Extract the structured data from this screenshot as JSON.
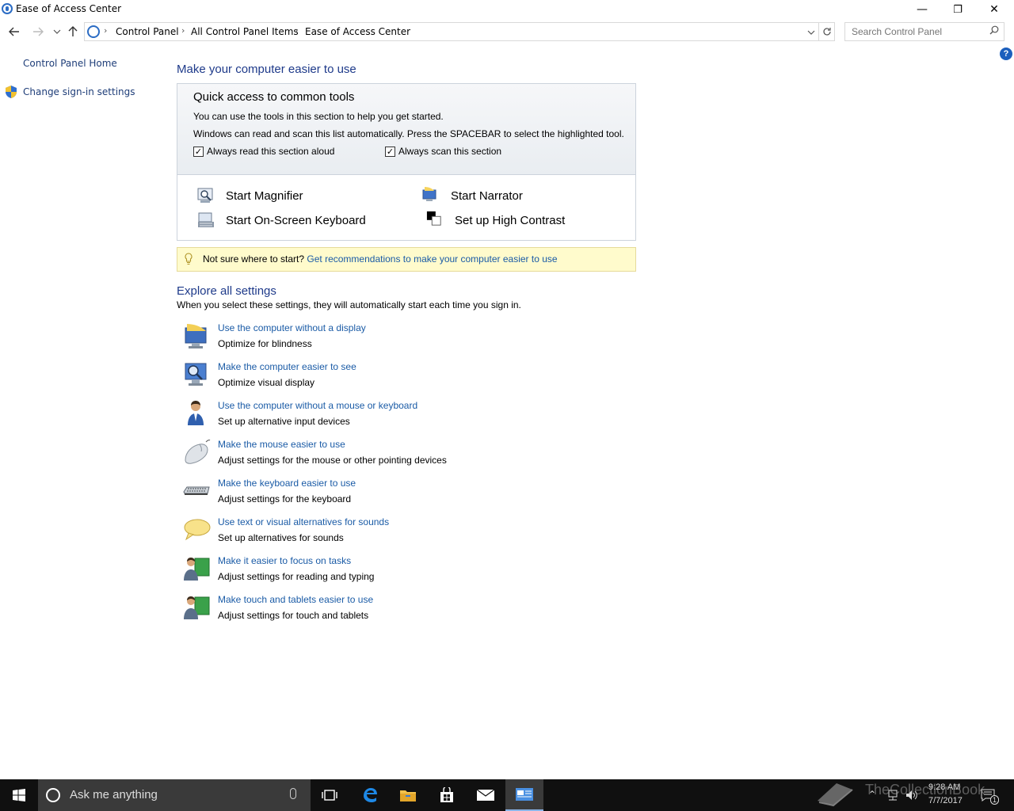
{
  "window": {
    "title": "Ease of Access Center",
    "minimize": "—",
    "restore": "❐",
    "close": "✕"
  },
  "address": {
    "crumbs": [
      "Control Panel",
      "All Control Panel Items",
      "Ease of Access Center"
    ],
    "search_placeholder": "Search Control Panel"
  },
  "left_nav": {
    "home": "Control Panel Home",
    "signin": "Change sign-in settings"
  },
  "help_label": "?",
  "main": {
    "heading": "Make your computer easier to use",
    "quick": {
      "heading": "Quick access to common tools",
      "line1": "You can use the tools in this section to help you get started.",
      "line2": "Windows can read and scan this list automatically.  Press the SPACEBAR to select the highlighted tool.",
      "read_aloud": {
        "label": "Always read this section aloud",
        "checked": true
      },
      "scan": {
        "label": "Always scan this section",
        "checked": true
      },
      "tools": {
        "magnifier": "Start Magnifier",
        "narrator": "Start Narrator",
        "osk": "Start On-Screen Keyboard",
        "contrast": "Set up High Contrast"
      }
    },
    "tip": {
      "prefix": "Not sure where to start?",
      "link": "Get recommendations to make your computer easier to use"
    },
    "explore": {
      "heading": "Explore all settings",
      "desc": "When you select these settings, they will automatically start each time you sign in.",
      "items": [
        {
          "link": "Use the computer without a display",
          "sub": "Optimize for blindness",
          "icon": "monitor-speaker-icon"
        },
        {
          "link": "Make the computer easier to see",
          "sub": "Optimize visual display",
          "icon": "monitor-magnifier-icon"
        },
        {
          "link": "Use the computer without a mouse or keyboard",
          "sub": "Set up alternative input devices",
          "icon": "person-icon"
        },
        {
          "link": "Make the mouse easier to use",
          "sub": "Adjust settings for the mouse or other pointing devices",
          "icon": "mouse-icon"
        },
        {
          "link": "Make the keyboard easier to use",
          "sub": "Adjust settings for the keyboard",
          "icon": "keyboard-icon"
        },
        {
          "link": "Use text or visual alternatives for sounds",
          "sub": "Set up alternatives for sounds",
          "icon": "speech-bubble-icon"
        },
        {
          "link": "Make it easier to focus on tasks",
          "sub": "Adjust settings for reading and typing",
          "icon": "users-icon"
        },
        {
          "link": "Make touch and tablets easier to use",
          "sub": "Adjust settings for touch and tablets",
          "icon": "users-icon"
        }
      ]
    }
  },
  "taskbar": {
    "search_placeholder": "Ask me anything",
    "time": "9:28 AM",
    "date": "7/7/2017",
    "notification_count": "1",
    "watermark": "TheCollectionBook"
  },
  "colors": {
    "link": "#1a5ba6",
    "heading": "#1e3a8a",
    "tip_bg": "#fffbcc",
    "taskbar": "#101010"
  }
}
